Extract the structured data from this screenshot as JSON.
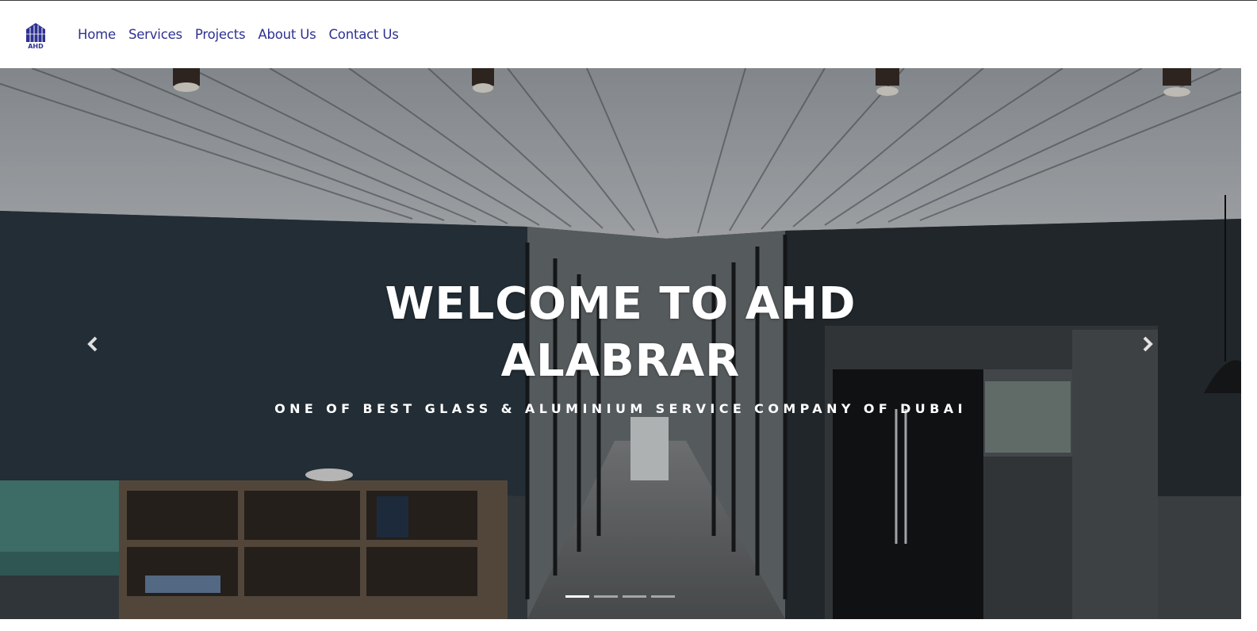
{
  "brand": {
    "logo_text": "AHD",
    "accent": "#2e3192"
  },
  "nav": {
    "items": [
      {
        "label": "Home"
      },
      {
        "label": "Services"
      },
      {
        "label": "Projects"
      },
      {
        "label": "About Us"
      },
      {
        "label": "Contact Us"
      }
    ]
  },
  "hero": {
    "title": "WELCOME TO AHD ALABRAR",
    "subtitle": "ONE OF BEST GLASS & ALUMINIUM SERVICE COMPANY OF DUBAI",
    "prev_icon": "chevron-left-icon",
    "next_icon": "chevron-right-icon",
    "slides_total": 4,
    "active_slide": 1
  }
}
